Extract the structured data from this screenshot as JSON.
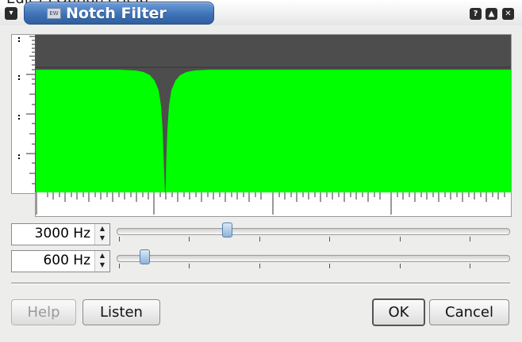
{
  "window": {
    "title": "Notch Filter",
    "behind_menu_text": "Edit                     ts  Options  Help",
    "controls": {
      "menu": "▾",
      "help": "?",
      "shade": "▲",
      "close": "✕"
    }
  },
  "controls": {
    "frequency": {
      "value": "3000 Hz",
      "slider_fraction": 0.275
    },
    "width": {
      "value": "600 Hz",
      "slider_fraction": 0.06
    }
  },
  "buttons": {
    "help": "Help",
    "listen": "Listen",
    "ok": "OK",
    "cancel": "Cancel"
  },
  "colors": {
    "plot_fill": "#00ff00",
    "plot_background": "#4d4d4d",
    "title_bar": "#3f73b8"
  }
}
